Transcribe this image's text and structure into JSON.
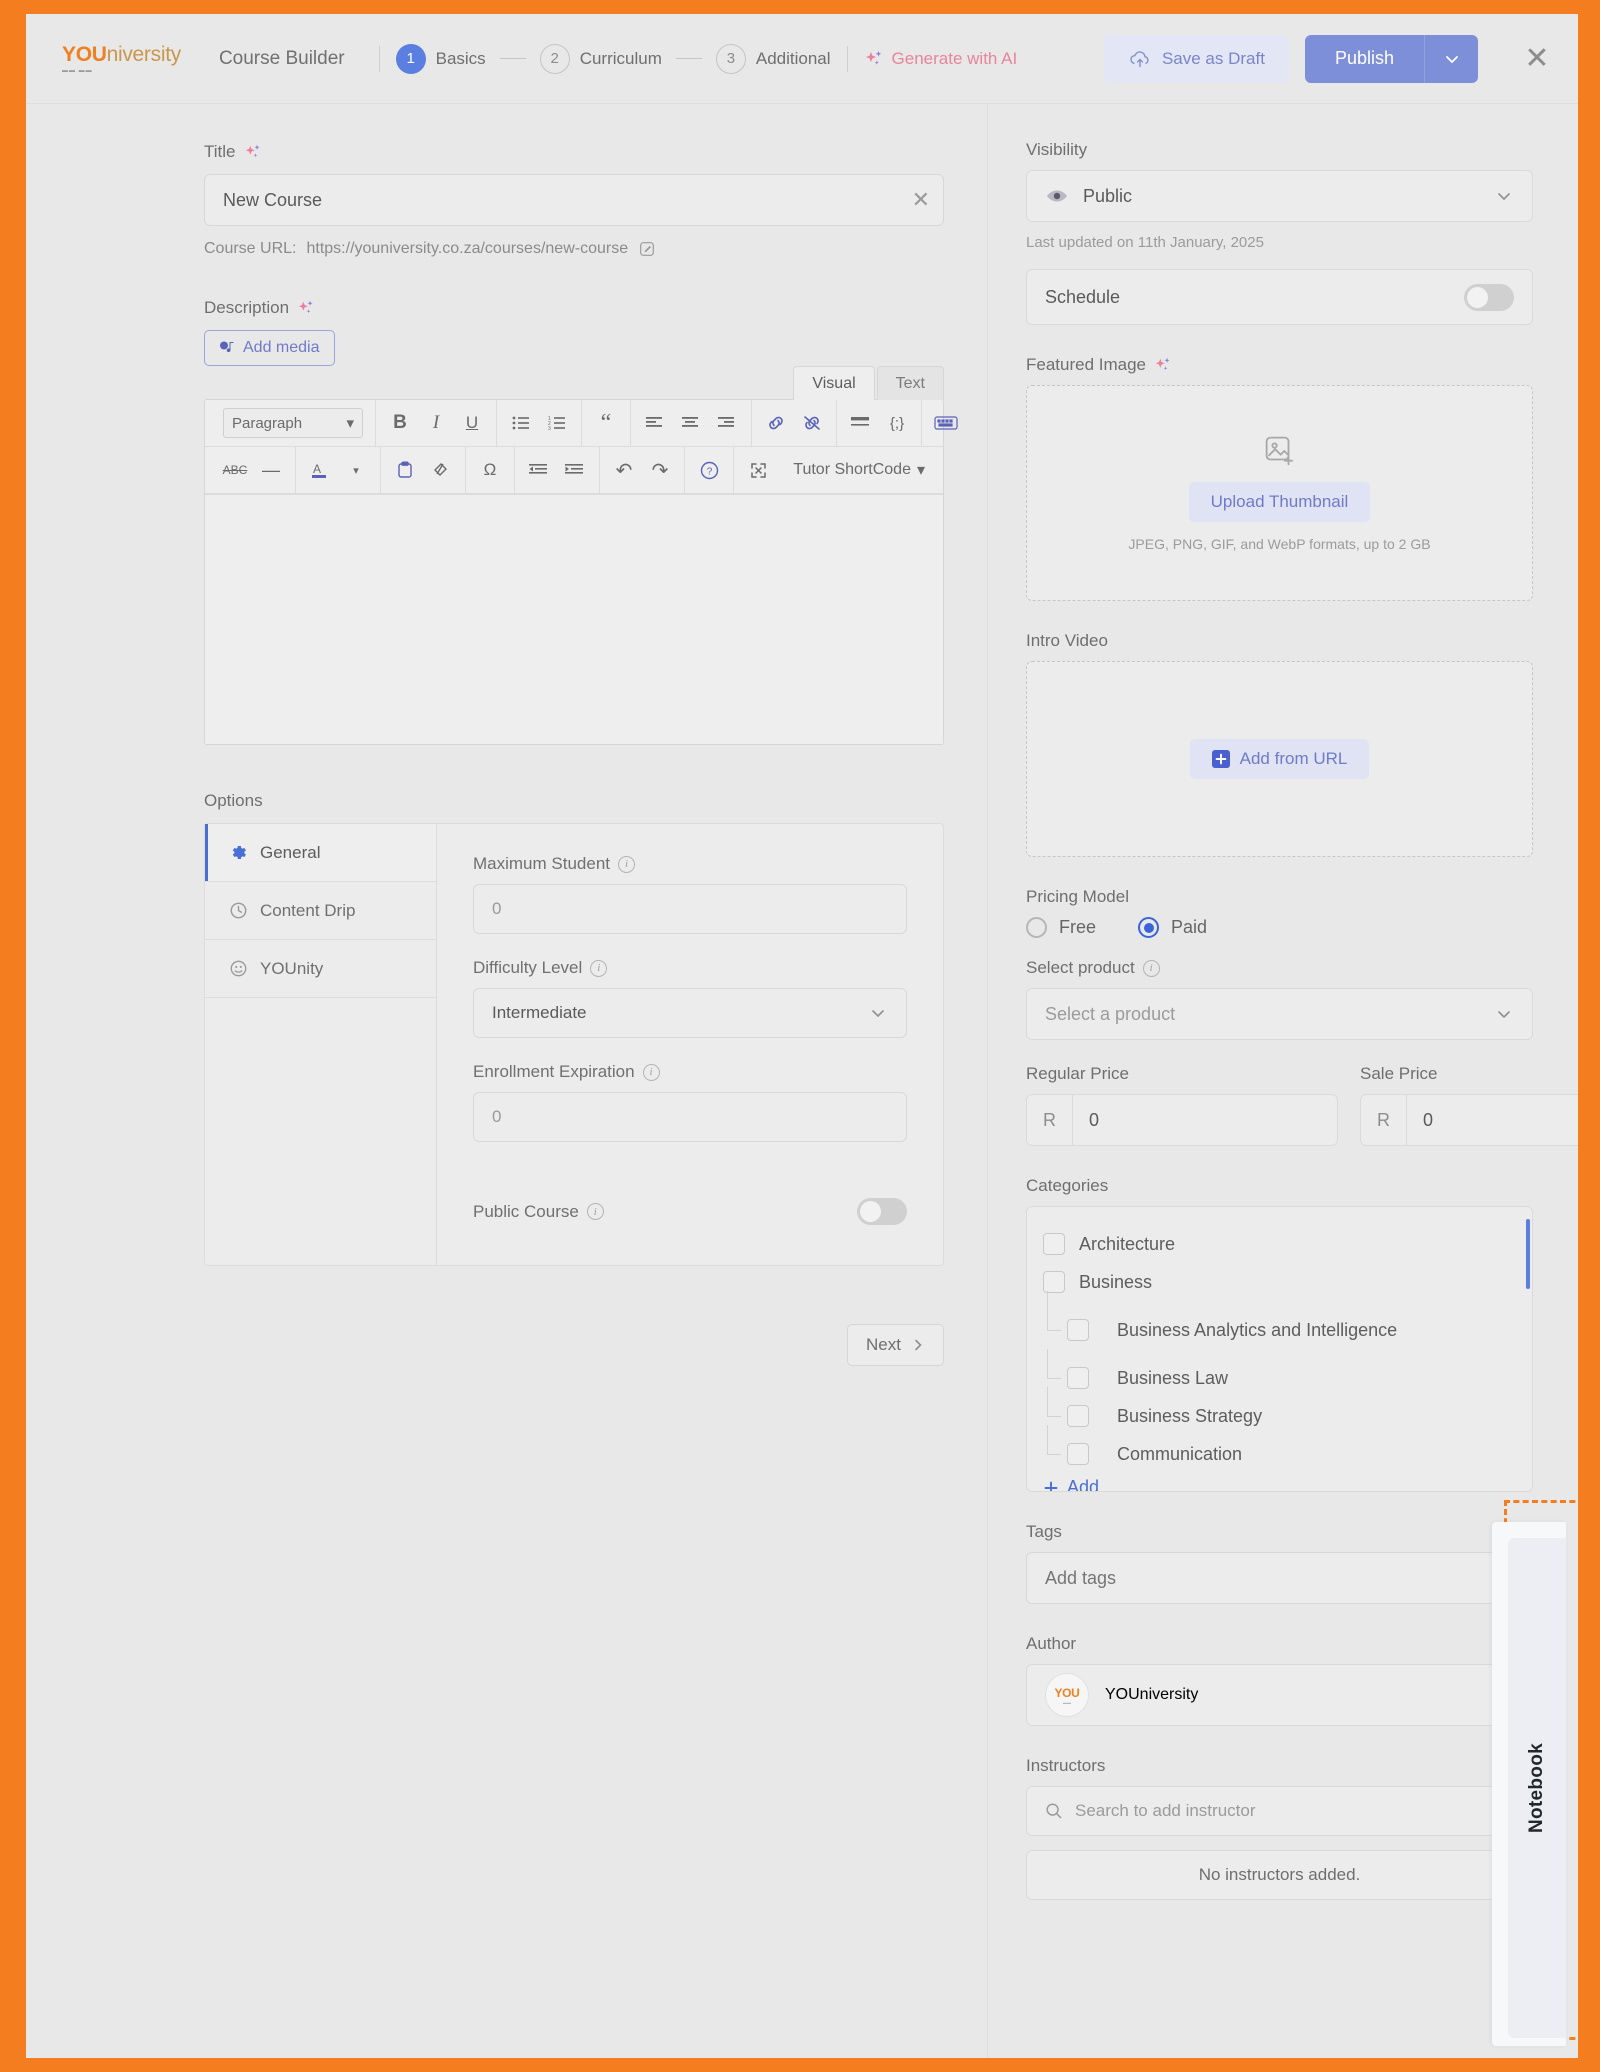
{
  "header": {
    "logo_main": "YOU",
    "logo_rest": "niversity",
    "logo_tagline": "",
    "builder_title": "Course Builder",
    "steps": [
      {
        "num": "1",
        "label": "Basics",
        "state": "active"
      },
      {
        "num": "2",
        "label": "Curriculum",
        "state": "idle"
      },
      {
        "num": "3",
        "label": "Additional",
        "state": "idle"
      }
    ],
    "generate_ai": "Generate with AI",
    "save_draft": "Save as Draft",
    "publish": "Publish",
    "close": "✕",
    "accent_blue": "#7e8fd9",
    "accent_orange": "#f47d1f",
    "accent_pink": "#e8849c"
  },
  "left": {
    "title_label": "Title",
    "title_value": "New Course",
    "course_url_prefix": "Course URL:",
    "course_url": "https://youniversity.co.za/courses/new-course",
    "description_label": "Description",
    "add_media": "Add media",
    "editor_tabs": [
      {
        "label": "Visual",
        "active": true
      },
      {
        "label": "Text",
        "active": false
      }
    ],
    "format_select": "Paragraph",
    "toolbar_row1": [
      {
        "name": "bold-icon",
        "glyph": "B"
      },
      {
        "name": "italic-icon",
        "glyph": "I"
      },
      {
        "name": "underline-icon",
        "glyph": "U"
      },
      {
        "name": "bulleted-list-icon",
        "glyph": "☰"
      },
      {
        "name": "numbered-list-icon",
        "glyph": "≡"
      },
      {
        "name": "blockquote-icon",
        "glyph": "“"
      },
      {
        "name": "align-left-icon",
        "glyph": "≡"
      },
      {
        "name": "align-center-icon",
        "glyph": "≡"
      },
      {
        "name": "align-right-icon",
        "glyph": "≡"
      },
      {
        "name": "insert-link-icon",
        "glyph": "🔗"
      },
      {
        "name": "remove-link-icon",
        "glyph": "⛓"
      },
      {
        "name": "read-more-icon",
        "glyph": "▬"
      },
      {
        "name": "code-icon",
        "glyph": "{;}"
      },
      {
        "name": "keyboard-shortcuts-icon",
        "glyph": "⌨"
      }
    ],
    "toolbar_row2": [
      {
        "name": "strikethrough-icon",
        "glyph": "ABC"
      },
      {
        "name": "horizontal-rule-icon",
        "glyph": "—"
      },
      {
        "name": "text-color-icon",
        "glyph": "A"
      },
      {
        "name": "paste-as-text-icon",
        "glyph": "📋"
      },
      {
        "name": "clear-formatting-icon",
        "glyph": "⌧"
      },
      {
        "name": "special-character-icon",
        "glyph": "Ω"
      },
      {
        "name": "outdent-icon",
        "glyph": "⇤"
      },
      {
        "name": "indent-icon",
        "glyph": "⇥"
      },
      {
        "name": "undo-icon",
        "glyph": "↶"
      },
      {
        "name": "redo-icon",
        "glyph": "↷"
      },
      {
        "name": "help-icon",
        "glyph": "?"
      },
      {
        "name": "fullscreen-icon",
        "glyph": "⤡"
      }
    ],
    "shortcode_label": "Tutor ShortCode",
    "editor_content": "",
    "options_label": "Options",
    "option_tabs": [
      {
        "label": "General",
        "icon": "gear-icon",
        "active": true
      },
      {
        "label": "Content Drip",
        "icon": "clock-icon",
        "active": false
      },
      {
        "label": "YOUnity",
        "icon": "younity-icon",
        "active": false
      }
    ],
    "max_student_label": "Maximum Student",
    "max_student_value": "0",
    "difficulty_label": "Difficulty Level",
    "difficulty_value": "Intermediate",
    "enrollment_label": "Enrollment Expiration",
    "enrollment_value": "0",
    "public_course_label": "Public Course",
    "public_course_on": false,
    "next_label": "Next"
  },
  "right": {
    "visibility_label": "Visibility",
    "visibility_value": "Public",
    "last_updated": "Last updated on 11th January, 2025",
    "schedule_label": "Schedule",
    "schedule_on": false,
    "featured_image_label": "Featured Image",
    "upload_thumbnail": "Upload Thumbnail",
    "thumbnail_hint": "JPEG, PNG, GIF, and WebP formats, up to 2 GB",
    "intro_video_label": "Intro Video",
    "add_from_url": "Add from URL",
    "pricing_label": "Pricing Model",
    "pricing_options": [
      {
        "label": "Free",
        "selected": false
      },
      {
        "label": "Paid",
        "selected": true
      }
    ],
    "select_product_label": "Select product",
    "select_product_placeholder": "Select a product",
    "regular_price_label": "Regular Price",
    "regular_price_currency": "R",
    "regular_price_value": "0",
    "sale_price_label": "Sale Price",
    "sale_price_currency": "R",
    "sale_price_value": "0",
    "categories_label": "Categories",
    "categories": [
      {
        "label": "Architecture",
        "level": 0,
        "checked": false
      },
      {
        "label": "Business",
        "level": 0,
        "checked": false
      },
      {
        "label": "Business Analytics and Intelligence",
        "level": 1,
        "checked": false
      },
      {
        "label": "Business Law",
        "level": 1,
        "checked": false
      },
      {
        "label": "Business Strategy",
        "level": 1,
        "checked": false
      },
      {
        "label": "Communication",
        "level": 1,
        "checked": false
      }
    ],
    "categories_add": "Add",
    "tags_label": "Tags",
    "tags_placeholder": "Add tags",
    "author_label": "Author",
    "author_name": "YOUniversity",
    "author_avatar_text": "YOU",
    "instructors_label": "Instructors",
    "instructors_placeholder": "Search to add instructor",
    "instructors_empty": "No instructors added."
  },
  "notebook": {
    "label": "Notebook"
  }
}
